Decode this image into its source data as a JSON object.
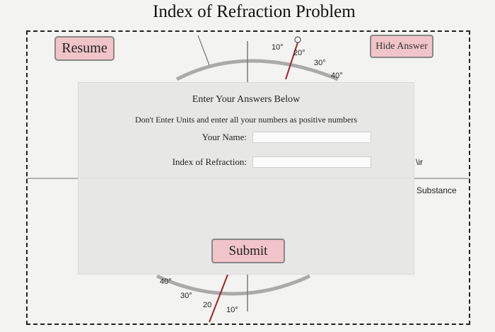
{
  "page": {
    "title": "Index of Refraction Problem"
  },
  "buttons": {
    "resume": "Resume",
    "hide_answer": "Hide Answer",
    "submit": "Submit"
  },
  "protractor": {
    "top_labels": [
      "10°",
      "20°",
      "30°",
      "40°"
    ],
    "bottom_labels": [
      "40°",
      "30°",
      "20",
      "10°"
    ],
    "colors": {
      "ray": "#a0202a",
      "scale": "#999999"
    }
  },
  "media": {
    "air_label": "\\ir",
    "substance_label": "Substance"
  },
  "dialog": {
    "heading": "Enter Your Answers Below",
    "note": "Don't Enter Units and enter all your numbers as positive numbers",
    "name_label": "Your Name:",
    "name_value": "",
    "index_label": "Index of Refraction:",
    "index_value": ""
  }
}
